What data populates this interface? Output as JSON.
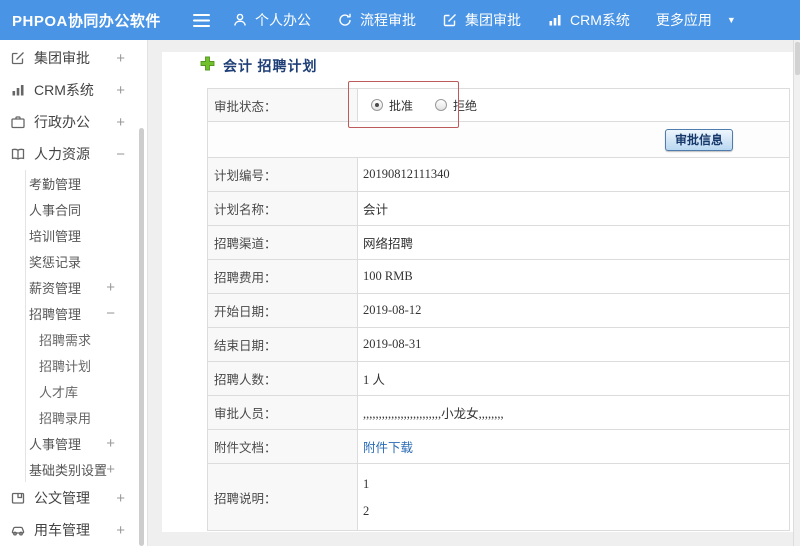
{
  "topbar": {
    "logo": "PHPOA协同办公软件",
    "nav": [
      {
        "label": "个人办公",
        "icon": "user-icon"
      },
      {
        "label": "流程审批",
        "icon": "process-icon"
      },
      {
        "label": "集团审批",
        "icon": "compose-icon"
      },
      {
        "label": "CRM系统",
        "icon": "bar-chart-icon"
      },
      {
        "label": "更多应用",
        "icon": "caret-down-icon"
      }
    ],
    "caret": "▼"
  },
  "sidebar": {
    "items": [
      {
        "label": "集团审批",
        "toggle": "+",
        "icon": "compose-icon"
      },
      {
        "label": "CRM系统",
        "toggle": "+",
        "icon": "bar-chart-icon"
      },
      {
        "label": "行政办公",
        "toggle": "+",
        "icon": "briefcase-icon"
      },
      {
        "label": "人力资源",
        "toggle": "−",
        "icon": "book-icon"
      },
      {
        "label": "考勤管理",
        "toggle": ""
      },
      {
        "label": "人事合同",
        "toggle": ""
      },
      {
        "label": "培训管理",
        "toggle": ""
      },
      {
        "label": "奖惩记录",
        "toggle": ""
      },
      {
        "label": "薪资管理",
        "toggle": "+"
      },
      {
        "label": "招聘管理",
        "toggle": "−"
      },
      {
        "label": "招聘需求",
        "toggle": ""
      },
      {
        "label": "招聘计划",
        "toggle": ""
      },
      {
        "label": "人才库",
        "toggle": ""
      },
      {
        "label": "招聘录用",
        "toggle": ""
      },
      {
        "label": "人事管理",
        "toggle": "+"
      },
      {
        "label": "基础类别设置",
        "toggle": "+"
      },
      {
        "label": "公文管理",
        "toggle": "+",
        "icon": "document-icon"
      },
      {
        "label": "用车管理",
        "toggle": "+",
        "icon": "car-icon"
      }
    ]
  },
  "main": {
    "title": "会计 招聘计划",
    "title_icon": "plus-icon"
  },
  "form": {
    "status_label": "审批状态：",
    "radios": [
      {
        "label": "批准",
        "checked": true
      },
      {
        "label": "拒绝",
        "checked": false
      }
    ],
    "approve_button": "审批信息",
    "rows": [
      {
        "label": "计划编号：",
        "value": "20190812111340"
      },
      {
        "label": "计划名称：",
        "value": "会计"
      },
      {
        "label": "招聘渠道：",
        "value": "网络招聘"
      },
      {
        "label": "招聘费用：",
        "value": "100 RMB"
      },
      {
        "label": "开始日期：",
        "value": "2019-08-12"
      },
      {
        "label": "结束日期：",
        "value": "2019-08-31"
      },
      {
        "label": "招聘人数：",
        "value": "1 人"
      },
      {
        "label": "审批人员：",
        "value": ",,,,,,,,,,,,,,,,,,,,,,,,,小龙女,,,,,,,,"
      },
      {
        "label": "附件文档：",
        "value": "附件下载"
      },
      {
        "label": "招聘说明：",
        "lines": [
          "1",
          "2"
        ]
      }
    ]
  },
  "colors": {
    "topbar_blue": "#4a94e6",
    "annotation_red": "#bd5b5b",
    "link_blue": "#2b6cb5",
    "plus_green": "#72c02c",
    "title_navy": "#1f3f77"
  }
}
